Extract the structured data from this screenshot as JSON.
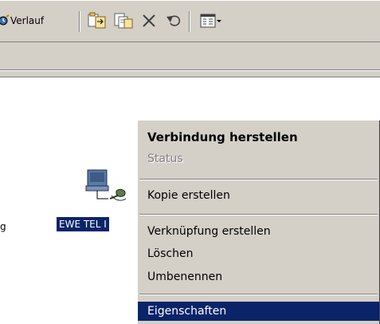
{
  "toolbar": {
    "history_label": "Verlauf",
    "buttons": [
      {
        "icon": "move-to-icon"
      },
      {
        "icon": "copy-to-icon"
      },
      {
        "icon": "delete-icon"
      },
      {
        "icon": "undo-icon"
      },
      {
        "icon": "views-icon"
      }
    ]
  },
  "content": {
    "left_item_label": "g",
    "selected_item_label": "EWE TEL I"
  },
  "context_menu": {
    "items": [
      {
        "label": "Verbindung herstellen",
        "bold": true
      },
      {
        "label": "Status",
        "disabled": true
      },
      {
        "label": "Kopie erstellen"
      },
      {
        "label": "Verknüpfung erstellen"
      },
      {
        "label": "Löschen"
      },
      {
        "label": "Umbenennen"
      },
      {
        "label": "Eigenschaften",
        "highlighted": true
      }
    ]
  },
  "colors": {
    "chrome": "#d4d0c8",
    "selection": "#0a246a"
  }
}
